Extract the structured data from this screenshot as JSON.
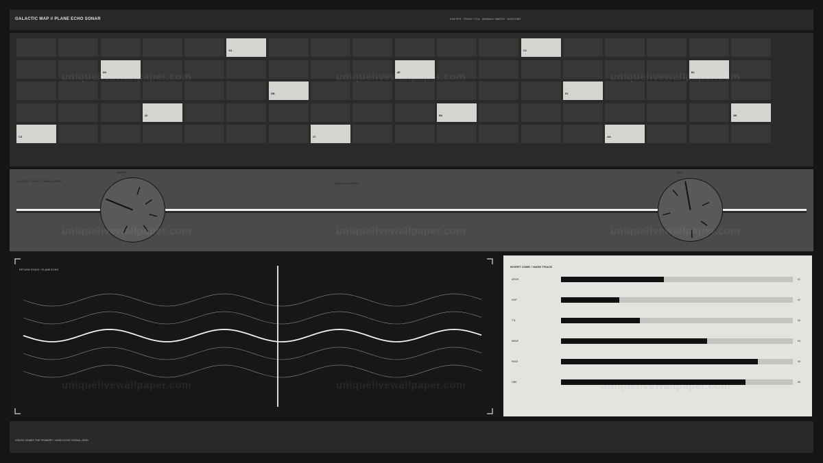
{
  "header": {
    "title": "GALACTIC MAP // PLANE ECHO SONAR",
    "readout": "3.88 PPS · TRACE 77CA · ANOMALY WATCH · H/SIG SNR"
  },
  "grid": {
    "rows": 5,
    "cols": 18,
    "lit_cells": [
      {
        "row": 0,
        "col": 5,
        "code": "D1"
      },
      {
        "row": 0,
        "col": 12,
        "code": "C2"
      },
      {
        "row": 1,
        "col": 2,
        "code": "D9"
      },
      {
        "row": 1,
        "col": 9,
        "code": "4E"
      },
      {
        "row": 1,
        "col": 16,
        "code": "B1"
      },
      {
        "row": 2,
        "col": 6,
        "code": "DB"
      },
      {
        "row": 2,
        "col": 13,
        "code": "51"
      },
      {
        "row": 3,
        "col": 3,
        "code": "42"
      },
      {
        "row": 3,
        "col": 10,
        "code": "B0"
      },
      {
        "row": 3,
        "col": 17,
        "code": "3B"
      },
      {
        "row": 4,
        "col": 0,
        "code": "C4"
      },
      {
        "row": 4,
        "col": 7,
        "code": "27"
      },
      {
        "row": 4,
        "col": 14,
        "code": "AA"
      }
    ]
  },
  "timeline": {
    "label": "GALACTIC TYLINE / TYING MARKER",
    "center_label": "SIGNAL SEQUENCE",
    "dial_left_caption": "SOURCE",
    "dial_right_caption": "ECHO"
  },
  "waves": {
    "label": "RETURN STACK / PLANE ECHO"
  },
  "bars": {
    "label": "INVERT ZONE / HASH TRACE",
    "items": [
      {
        "name": "ARGH",
        "value": 44,
        "fraction": 0.444,
        "value_label": "01"
      },
      {
        "name": "HOP",
        "value": 25,
        "fraction": 0.252,
        "value_label": "02"
      },
      {
        "name": "TTL",
        "value": 34,
        "fraction": 0.34,
        "value_label": "03"
      },
      {
        "name": "WAVE",
        "value": 63,
        "fraction": 0.629,
        "value_label": "04"
      },
      {
        "name": "PASS",
        "value": 85,
        "fraction": 0.849,
        "value_label": "05"
      },
      {
        "name": "ORE",
        "value": 79,
        "fraction": 0.795,
        "value_label": "06"
      }
    ]
  },
  "footer": {
    "text": "VISION GAMES THE PRIMARY / HASH ECHO SIGNAL GRID"
  },
  "watermark": {
    "text": "uniquelivewallpaper.com"
  },
  "colors": {
    "background": "#141614",
    "panel": "#292b29",
    "lit_cell": "#d4d4d0",
    "timeline_bg": "#4a4b49",
    "bar_fill": "#111111",
    "bar_track": "#c4c5c1",
    "bar_panel": "#e3e4e0"
  }
}
